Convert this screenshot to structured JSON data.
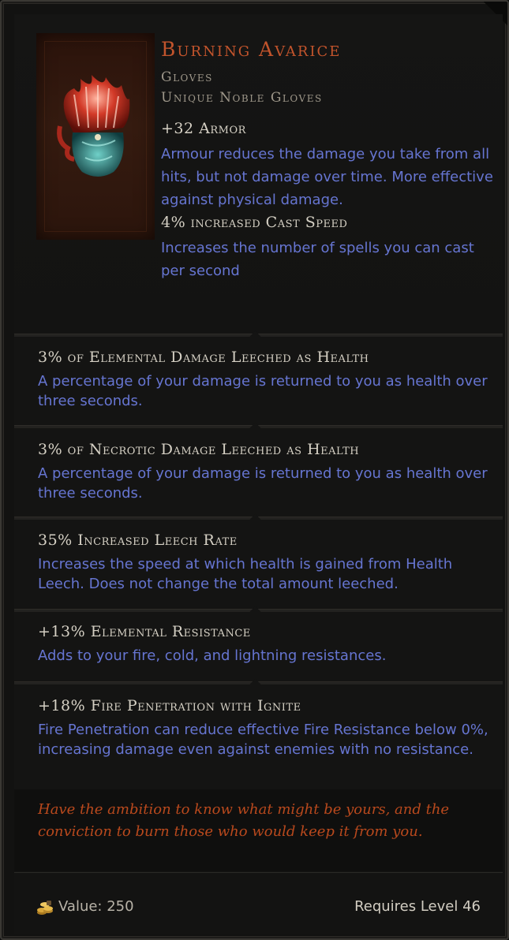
{
  "item": {
    "name": "Burning Avarice",
    "slot": "Gloves",
    "base": "Unique Noble Gloves",
    "icon": "flaming-gloves-icon"
  },
  "implicits": [
    {
      "stat": "+32 Armor",
      "desc": "Armour reduces the damage you take from all hits, but not damage over time. More effective against physical damage."
    },
    {
      "stat": "4% increased Cast Speed",
      "desc": "Increases the number of spells you can cast per second"
    }
  ],
  "affixes": [
    {
      "stat": "3% of Elemental Damage Leeched as Health",
      "desc": "A percentage of your damage is returned to you as health over three seconds."
    },
    {
      "stat": "3% of Necrotic Damage Leeched as Health",
      "desc": "A percentage of your damage is returned to you as health over three seconds."
    },
    {
      "stat": "35% Increased Leech Rate",
      "desc": "Increases the speed at which health is gained from Health Leech. Does not change the total amount leeched."
    },
    {
      "stat": "+13% Elemental Resistance",
      "desc": "Adds to your fire, cold, and lightning resistances."
    },
    {
      "stat": "+18% Fire Penetration with Ignite",
      "desc": "Fire Penetration can reduce effective Fire Resistance below 0%, increasing damage even against enemies with no resistance."
    }
  ],
  "lore": "Have the ambition to know what might be yours, and the conviction to burn those who would keep it from you.",
  "footer": {
    "value_label": "Value: 250",
    "coin_icon": "gold-coins-icon",
    "requires": "Requires Level 46"
  },
  "colors": {
    "unique_name": "#c2542c",
    "description": "#6675d1",
    "stat": "#d5d0c4",
    "lore": "#b9491d"
  }
}
